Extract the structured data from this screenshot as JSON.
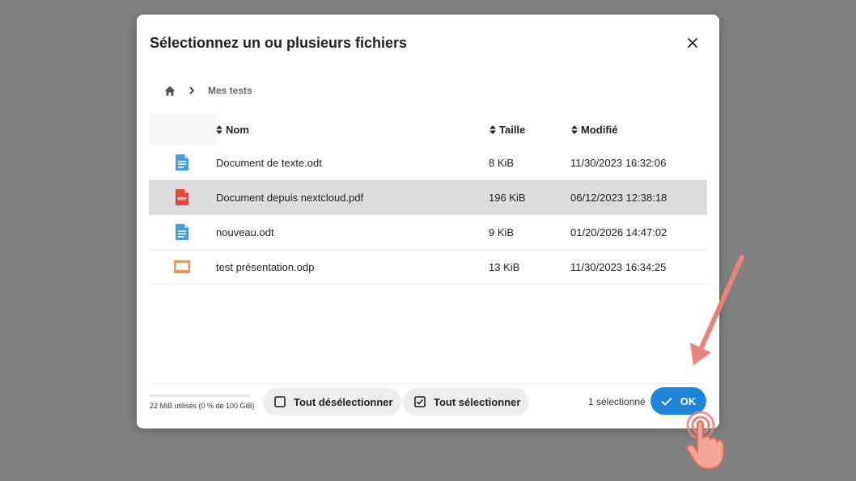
{
  "dialog": {
    "title": "Sélectionnez un ou plusieurs fichiers",
    "close_icon": "close-icon"
  },
  "breadcrumb": {
    "home_icon": "home-icon",
    "separator_icon": "chevron-right-icon",
    "current": "Mes tests"
  },
  "table": {
    "headers": {
      "name": "Nom",
      "size": "Taille",
      "modified": "Modifié"
    },
    "rows": [
      {
        "name": "Document de texte.odt",
        "size": "8 KiB",
        "modified": "11/30/2023 16:32:06",
        "icon": "text-document-icon",
        "selected": false
      },
      {
        "name": "Document depuis nextcloud.pdf",
        "size": "196 KiB",
        "modified": "06/12/2023 12:38:18",
        "icon": "pdf-icon",
        "selected": true
      },
      {
        "name": "nouveau.odt",
        "size": "9 KiB",
        "modified": "01/20/2026 14:47:02",
        "icon": "text-document-icon",
        "selected": false
      },
      {
        "name": "test présentation.odp",
        "size": "13 KiB",
        "modified": "11/30/2023 16:34:25",
        "icon": "presentation-icon",
        "selected": false
      }
    ]
  },
  "footer": {
    "quota": "22 MiB utilisés (0 % de 100 GiB)",
    "deselect_all": "Tout désélectionner",
    "select_all": "Tout sélectionner",
    "selected_count": "1 sélectionné",
    "ok": "OK"
  },
  "colors": {
    "accent": "#1f85d6",
    "selected_row": "#dcdcdc",
    "overlay": "#808080",
    "annotation": "#e8837b"
  }
}
